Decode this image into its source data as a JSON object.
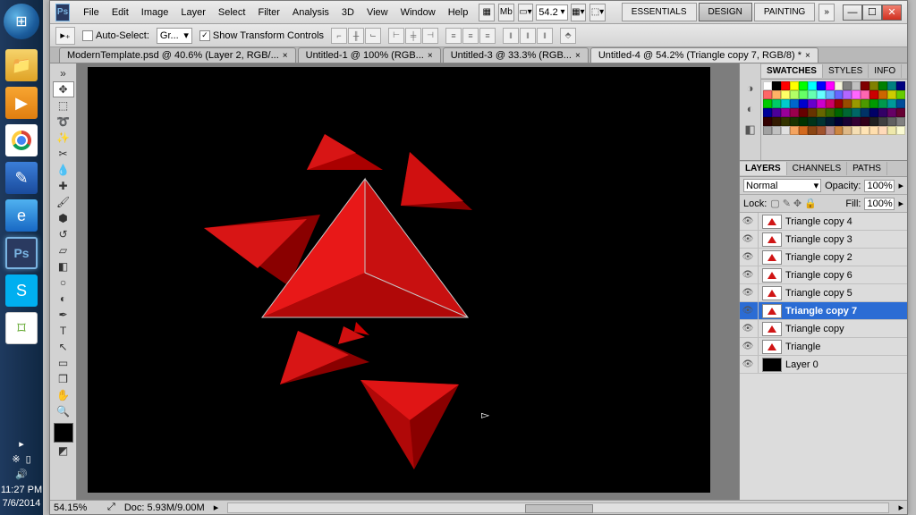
{
  "taskbar": {
    "time": "11:27 PM",
    "date": "7/6/2014"
  },
  "menubar": {
    "ps": "Ps",
    "items": [
      "File",
      "Edit",
      "Image",
      "Layer",
      "Select",
      "Filter",
      "Analysis",
      "3D",
      "View",
      "Window",
      "Help"
    ],
    "zoom": "54.2",
    "workspaces": [
      "ESSENTIALS",
      "DESIGN",
      "PAINTING"
    ],
    "active_workspace": 1,
    "arrows": "»"
  },
  "options": {
    "auto_select": "Auto-Select:",
    "auto_select_val": "Gr...",
    "show_transform": "Show Transform Controls"
  },
  "doc_tabs": [
    {
      "label": "ModernTemplate.psd @ 40.6% (Layer 2, RGB/...",
      "active": false
    },
    {
      "label": "Untitled-1 @ 100% (RGB...",
      "active": false
    },
    {
      "label": "Untitled-3 @ 33.3% (RGB...",
      "active": false
    },
    {
      "label": "Untitled-4 @ 54.2% (Triangle copy 7, RGB/8) *",
      "active": true
    }
  ],
  "swatches_tabs": [
    "SWATCHES",
    "STYLES",
    "INFO"
  ],
  "layers_tabs": [
    "LAYERS",
    "CHANNELS",
    "PATHS"
  ],
  "layers": {
    "blend": "Normal",
    "opacity_label": "Opacity:",
    "opacity": "100%",
    "lock_label": "Lock:",
    "fill_label": "Fill:",
    "fill": "100%",
    "rows": [
      {
        "name": "Triangle copy 4",
        "sel": false,
        "black": false
      },
      {
        "name": "Triangle copy 3",
        "sel": false,
        "black": false
      },
      {
        "name": "Triangle copy 2",
        "sel": false,
        "black": false
      },
      {
        "name": "Triangle copy 6",
        "sel": false,
        "black": false
      },
      {
        "name": "Triangle copy 5",
        "sel": false,
        "black": false
      },
      {
        "name": "Triangle copy 7",
        "sel": true,
        "black": false
      },
      {
        "name": "Triangle copy",
        "sel": false,
        "black": false
      },
      {
        "name": "Triangle",
        "sel": false,
        "black": false
      },
      {
        "name": "Layer 0",
        "sel": false,
        "black": true
      }
    ]
  },
  "status": {
    "zoom": "54.15%",
    "doc": "Doc: 5.93M/9.00M"
  },
  "swatch_colors": [
    "#ffffff",
    "#000000",
    "#ff0000",
    "#ffff00",
    "#00ff00",
    "#00ffff",
    "#0000ff",
    "#ff00ff",
    "#f5f5dc",
    "#808080",
    "#c0c0c0",
    "#800000",
    "#808000",
    "#008000",
    "#008080",
    "#000080",
    "#ff6666",
    "#ffb266",
    "#ffff66",
    "#b2ff66",
    "#66ff66",
    "#66ffb2",
    "#66ffff",
    "#66b2ff",
    "#6666ff",
    "#b266ff",
    "#ff66ff",
    "#ff66b2",
    "#cc0000",
    "#cc6600",
    "#cccc00",
    "#66cc00",
    "#00cc00",
    "#00cc66",
    "#00cccc",
    "#0066cc",
    "#0000cc",
    "#6600cc",
    "#cc00cc",
    "#cc0066",
    "#990000",
    "#994c00",
    "#999900",
    "#4c9900",
    "#009900",
    "#00994c",
    "#009999",
    "#004c99",
    "#000099",
    "#4c0099",
    "#990099",
    "#99004c",
    "#660000",
    "#663300",
    "#666600",
    "#336600",
    "#006600",
    "#006633",
    "#006666",
    "#003366",
    "#000066",
    "#330066",
    "#660066",
    "#660033",
    "#330000",
    "#331900",
    "#333300",
    "#193300",
    "#003300",
    "#003319",
    "#003333",
    "#001933",
    "#000033",
    "#190033",
    "#330033",
    "#330019",
    "#202020",
    "#404040",
    "#606060",
    "#808080",
    "#a0a0a0",
    "#c0c0c0",
    "#e0e0e0",
    "#f4a460",
    "#d2691e",
    "#8b4513",
    "#a0522d",
    "#bc8f8f",
    "#cd853f",
    "#deb887",
    "#f5deb3",
    "#ffe4b5",
    "#ffdead",
    "#ffdab9",
    "#eee8aa",
    "#fafad2"
  ]
}
